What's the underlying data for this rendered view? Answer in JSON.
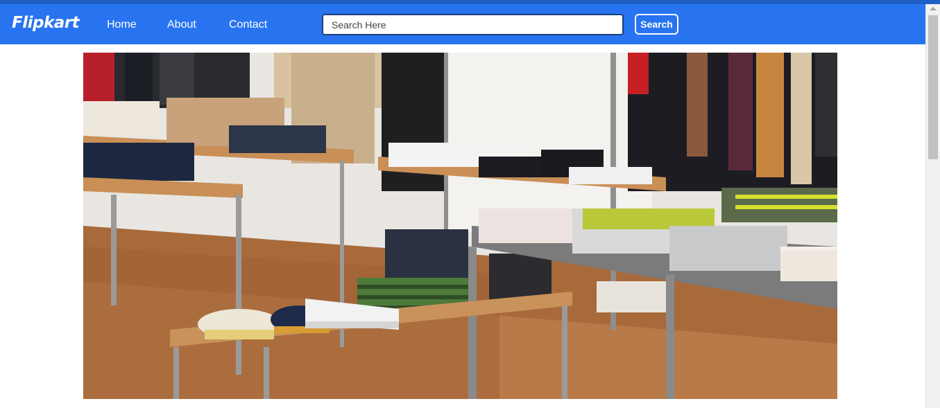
{
  "brand": {
    "name": "Flipkart"
  },
  "nav": {
    "items": [
      "Home",
      "About",
      "Contact"
    ]
  },
  "search": {
    "placeholder": "Search Here",
    "value": "",
    "button_label": "Search"
  },
  "hero": {
    "image": "clothing-store-interior"
  },
  "colors": {
    "navbar": "#2874f0",
    "top_strip": "#1f5fc4",
    "search_border": "#1b3f7a",
    "background": "#ffffff"
  }
}
